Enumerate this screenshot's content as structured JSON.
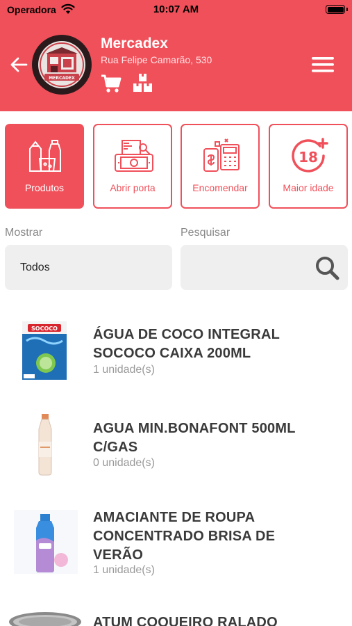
{
  "status_bar": {
    "carrier": "Operadora",
    "time": "10:07 AM"
  },
  "header": {
    "store_name": "Mercadex",
    "store_address": "Rua Felipe Camarão, 530",
    "logo_text": "MERCADEX",
    "accent_color": "#f0505a"
  },
  "actions": [
    {
      "label": "Produtos",
      "icon": "products-icon",
      "active": true
    },
    {
      "label": "Abrir porta",
      "icon": "open-door-icon",
      "active": false
    },
    {
      "label": "Encomendar",
      "icon": "order-icon",
      "active": false
    },
    {
      "label": "Maior idade",
      "icon": "age-18-icon",
      "active": false
    }
  ],
  "filters": {
    "show_label": "Mostrar",
    "show_value": "Todos",
    "search_label": "Pesquisar",
    "search_value": ""
  },
  "products": [
    {
      "name_lines": [
        "ÁGUA DE COCO INTEGRAL",
        "SOCOCO CAIXA 200ML"
      ],
      "qty": "1 unidade(s)",
      "thumb": "coconut-water-box"
    },
    {
      "name_lines": [
        "AGUA MIN.BONAFONT 500ML",
        "C/GAS"
      ],
      "qty": "0 unidade(s)",
      "thumb": "water-bottle"
    },
    {
      "name_lines": [
        "AMACIANTE DE ROUPA",
        "CONCENTRADO BRISA DE",
        "VERÃO"
      ],
      "qty": "1 unidade(s)",
      "thumb": "softener-bottle"
    },
    {
      "name_lines": [
        "ATUM COQUEIRO RALADO"
      ],
      "qty": "",
      "thumb": "tuna-can"
    }
  ]
}
